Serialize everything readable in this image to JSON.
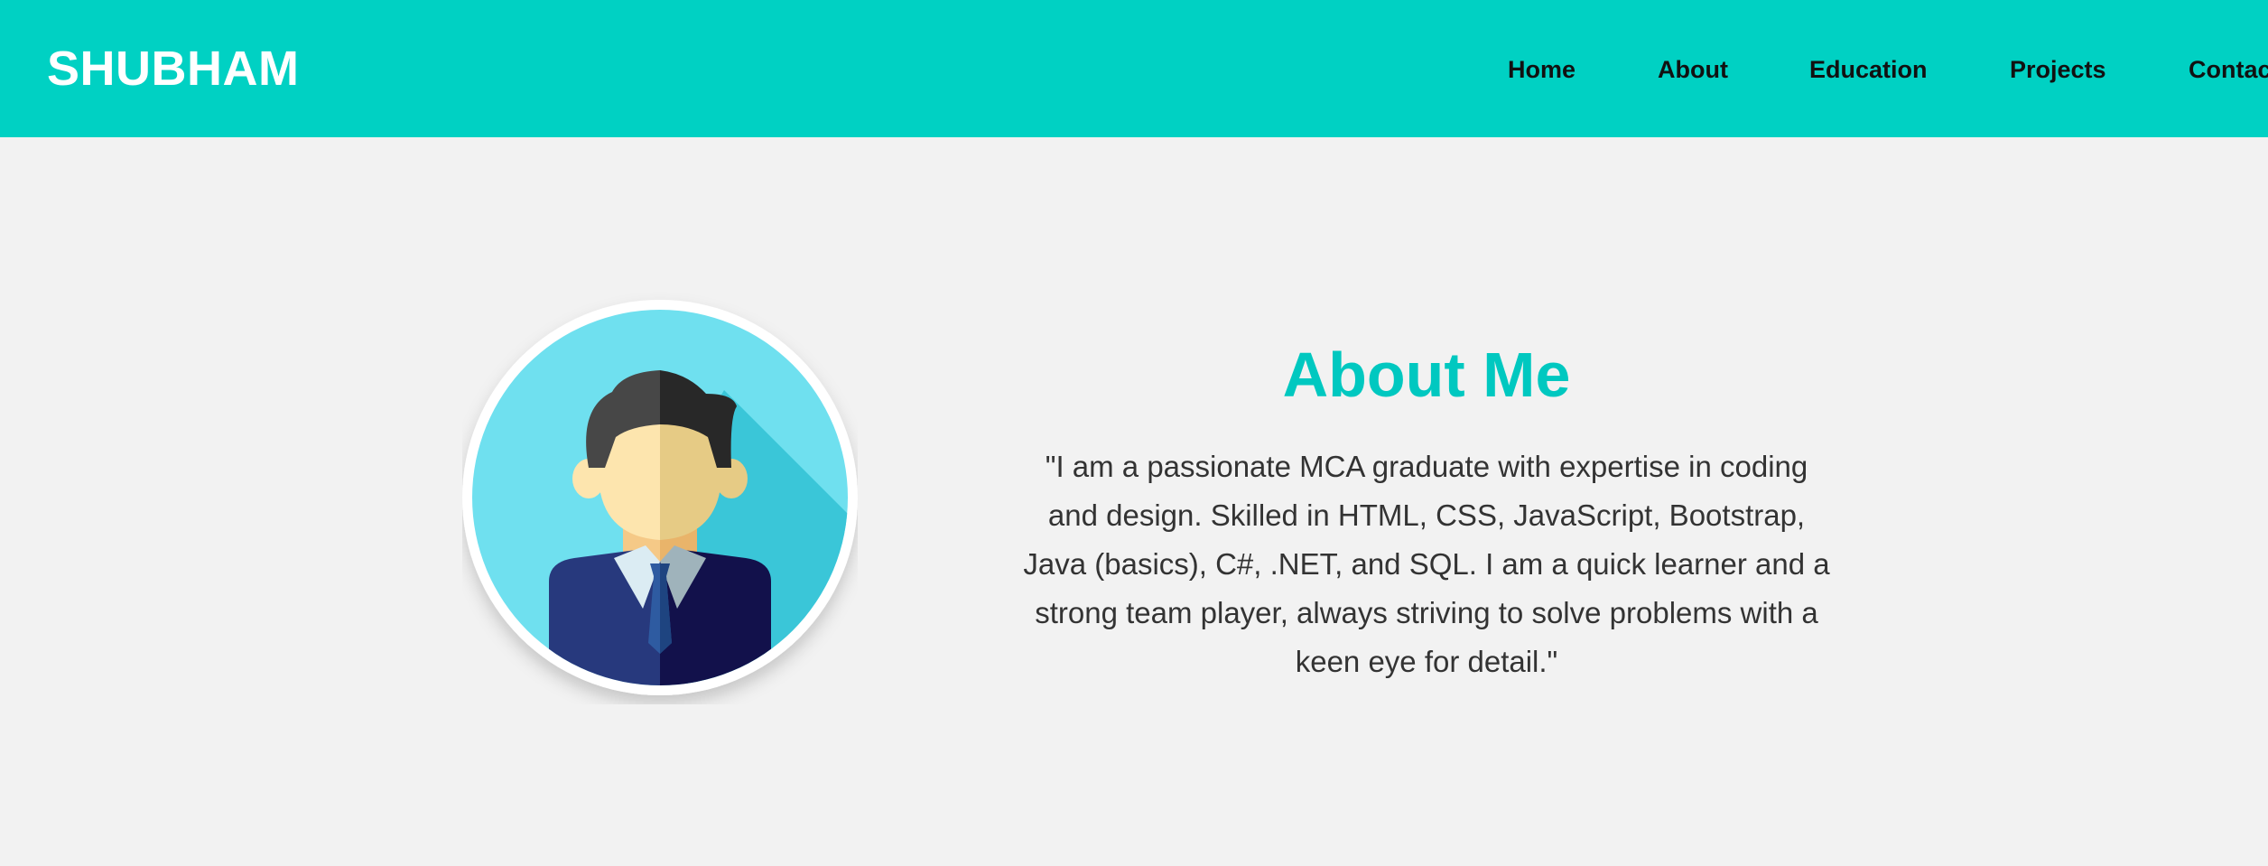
{
  "header": {
    "brand": "SHUBHAM",
    "nav": [
      {
        "label": "Home"
      },
      {
        "label": "About"
      },
      {
        "label": "Education"
      },
      {
        "label": "Projects"
      },
      {
        "label": "Contact"
      }
    ]
  },
  "about": {
    "title": "About Me",
    "text": "\"I am a passionate MCA graduate with expertise in coding and design. Skilled in HTML, CSS, JavaScript, Bootstrap, Java (basics), C#, .NET, and SQL. I am a quick learner and a strong team player, always striving to solve problems with a keen eye for detail.\"",
    "avatar_icon": "user-avatar-icon"
  },
  "colors": {
    "accent": "#00d1c3",
    "title": "#00c8c0",
    "background": "#f2f2f2",
    "text": "#333333"
  }
}
